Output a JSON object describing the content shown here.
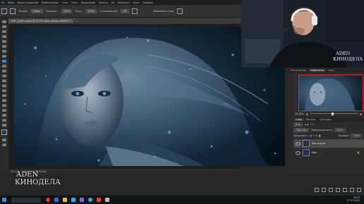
{
  "app": {
    "menu": [
      "Файл",
      "Редактирование",
      "Изображение",
      "Слои",
      "Текст",
      "Выделение",
      "Фильтр",
      "3D",
      "Просмотр",
      "Окно",
      "Справка"
    ],
    "options": {
      "mode_label": "Режим:",
      "mode_value": "Норм.",
      "opacity_label": "Непрозр.:",
      "opacity_value": "100%",
      "flow_label": "Наж.:",
      "flow_value": "100%",
      "smoothing_label": "Сглаживание:",
      "smoothing_value": "0%",
      "align_label": "Выровнять слои"
    },
    "document_tab": "DSC_0549 копия @ 33,3% (Фон копия, RGB/8*) *",
    "status": {
      "zoom": "33,33%",
      "doc_size": "Док: 23,7M/48,9M"
    }
  },
  "navigator": {
    "tabs": [
      "Гистограмма",
      "Навигатор",
      "Цвет"
    ],
    "active_tab": "Навигатор",
    "zoom": "33,33%",
    "zoom_fraction": 0.45
  },
  "layers": {
    "tabs": [
      "Слои",
      "Каналы",
      "Контуры"
    ],
    "active_tab": "Слои",
    "search_placeholder": "Вид",
    "blend_mode": "Обычные",
    "opacity_label": "Непрозрачность:",
    "opacity_value": "100%",
    "lock_label": "Закрепить:",
    "fill_label": "Заливка:",
    "fill_value": "100%",
    "items": [
      {
        "name": "Фон копия",
        "selected": true
      },
      {
        "name": "Фон",
        "selected": false
      }
    ]
  },
  "watermark": {
    "line1": "ADEN",
    "line2": "КИНОДЕЛА"
  },
  "taskbar": {
    "search_placeholder": "",
    "time": "19:42",
    "date": "17.07.2021"
  },
  "colors": {
    "accent_nav_frame": "#d03030",
    "canvas_bg": "#0b1a26",
    "taskbar_bg": "#101317"
  }
}
